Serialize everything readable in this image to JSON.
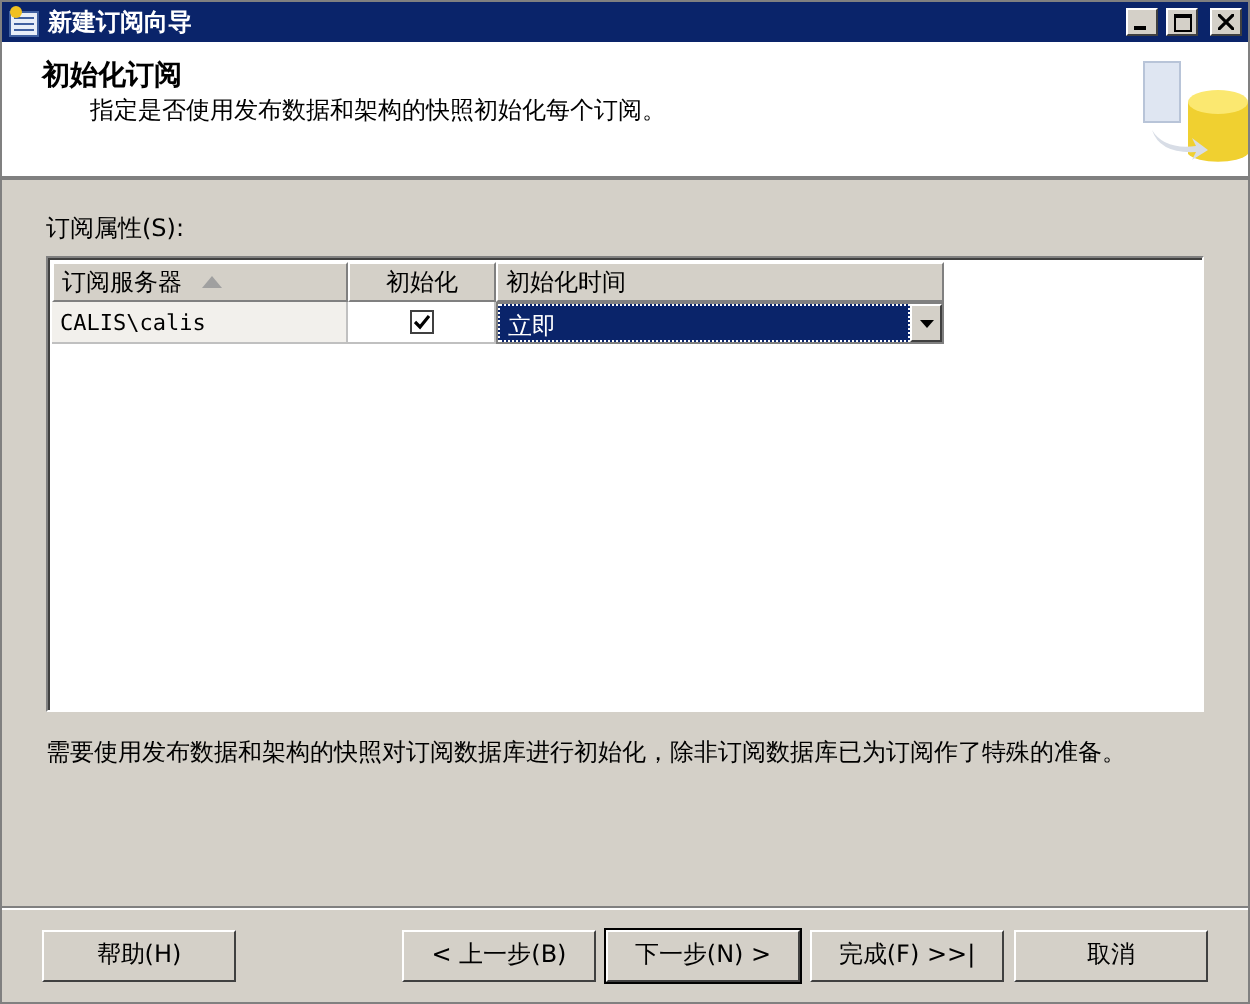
{
  "window": {
    "title": "新建订阅向导"
  },
  "header": {
    "title": "初始化订阅",
    "subtitle": "指定是否使用发布数据和架构的快照初始化每个订阅。"
  },
  "properties_label": "订阅属性(S):",
  "table": {
    "columns": [
      {
        "label": "订阅服务器",
        "sorted": true
      },
      {
        "label": "初始化",
        "sorted": false
      },
      {
        "label": "初始化时间",
        "sorted": false
      }
    ],
    "rows": [
      {
        "server": "CALIS\\calis",
        "initialize": true,
        "time": "立即",
        "time_selected": true
      }
    ]
  },
  "note": "需要使用发布数据和架构的快照对订阅数据库进行初始化，除非订阅数据库已为订阅作了特殊的准备。",
  "buttons": [
    {
      "label": "帮助(H)",
      "kind": "help",
      "default": false
    },
    {
      "label": "< 上一步(B)",
      "kind": "nav",
      "default": false
    },
    {
      "label": "下一步(N) >",
      "kind": "nav",
      "default": true
    },
    {
      "label": "完成(F) >>|",
      "kind": "nav",
      "default": false
    },
    {
      "label": "取消",
      "kind": "nav",
      "default": false
    }
  ]
}
